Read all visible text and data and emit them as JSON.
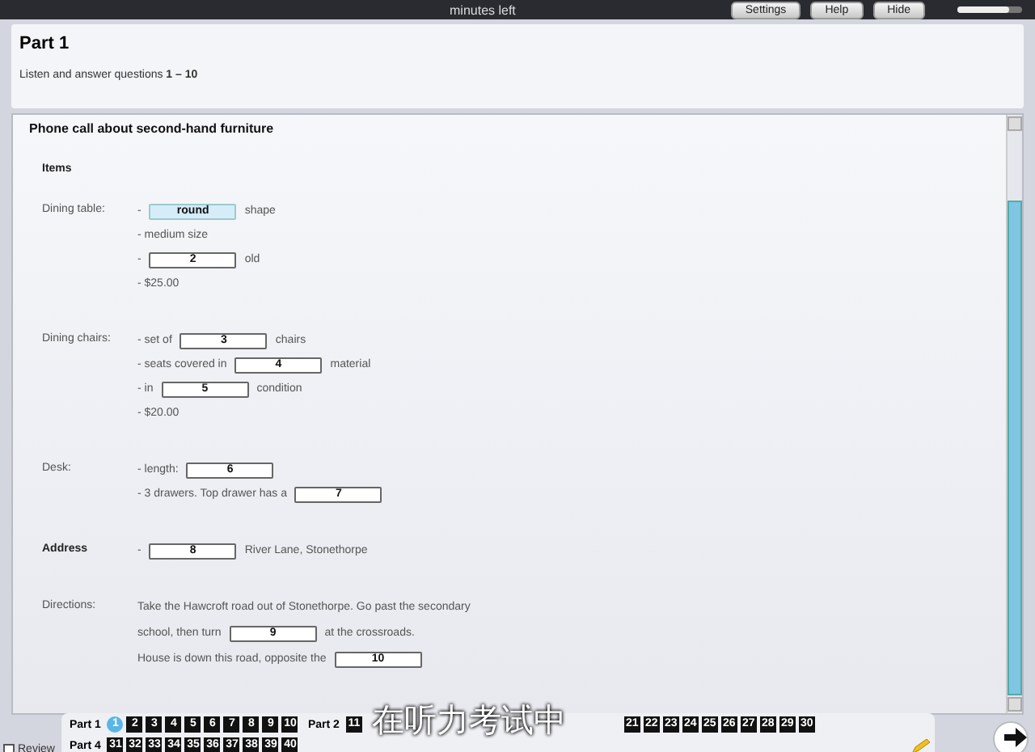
{
  "top_bar": {
    "timer": "minutes left",
    "volume": {
      "level": 0.8
    },
    "buttons": [
      {
        "label": "Settings"
      },
      {
        "label": "Help"
      },
      {
        "label": "Hide"
      }
    ]
  },
  "header": {
    "title": "Part 1",
    "instruction": "Listen and answer questions **1 – 10**"
  },
  "panel": {
    "title": "Phone call about second-hand furniture",
    "heading": "Items",
    "sections": [
      {
        "label": "Dining table:",
        "bold": false,
        "lines": [
          [
            {
              "kind": "text",
              "text": "-"
            },
            {
              "kind": "field",
              "value": "round",
              "focused": true
            },
            {
              "kind": "text",
              "text": "shape"
            }
          ],
          [
            {
              "kind": "text",
              "text": "- medium size"
            }
          ],
          [
            {
              "kind": "text",
              "text": "-"
            },
            {
              "kind": "field",
              "value": "2",
              "focused": false
            },
            {
              "kind": "text",
              "text": "old"
            }
          ],
          [
            {
              "kind": "text",
              "text": "- $25.00"
            }
          ]
        ]
      },
      {
        "label": "Dining chairs:",
        "bold": false,
        "lines": [
          [
            {
              "kind": "text",
              "text": "- set of"
            },
            {
              "kind": "field",
              "value": "3",
              "focused": false
            },
            {
              "kind": "text",
              "text": "chairs"
            }
          ],
          [
            {
              "kind": "text",
              "text": "- seats covered in"
            },
            {
              "kind": "field",
              "value": "4",
              "focused": false
            },
            {
              "kind": "text",
              "text": "material"
            }
          ],
          [
            {
              "kind": "text",
              "text": "- in"
            },
            {
              "kind": "field",
              "value": "5",
              "focused": false
            },
            {
              "kind": "text",
              "text": "condition"
            }
          ],
          [
            {
              "kind": "text",
              "text": "- $20.00"
            }
          ]
        ]
      },
      {
        "label": "Desk:",
        "bold": false,
        "lines": [
          [
            {
              "kind": "text",
              "text": "- length:"
            },
            {
              "kind": "field",
              "value": "6",
              "focused": false
            }
          ],
          [
            {
              "kind": "text",
              "text": "- 3 drawers. Top drawer has a"
            },
            {
              "kind": "field",
              "value": "7",
              "focused": false
            }
          ]
        ]
      },
      {
        "label": "Address",
        "bold": true,
        "lines": [
          [
            {
              "kind": "text",
              "text": "-"
            },
            {
              "kind": "field",
              "value": "8",
              "focused": false
            },
            {
              "kind": "text",
              "text": "River Lane, Stonethorpe"
            }
          ]
        ]
      },
      {
        "label": "Directions:",
        "bold": false,
        "lines": [
          [
            {
              "kind": "text",
              "text": "Take the Hawcroft road out of Stonethorpe. Go past the secondary"
            }
          ],
          [
            {
              "kind": "text",
              "text": "school, then turn"
            },
            {
              "kind": "field",
              "value": "9",
              "focused": false
            },
            {
              "kind": "text",
              "text": "at the crossroads."
            }
          ],
          [
            {
              "kind": "text",
              "text": "House is down this road, opposite the"
            },
            {
              "kind": "field",
              "value": "10",
              "focused": false
            }
          ]
        ]
      }
    ]
  },
  "subtitle": "在听力考试中",
  "nav": {
    "review": {
      "label": "Review",
      "checked": false
    },
    "rows": [
      [
        {
          "label": "Part 1",
          "questions": [
            {
              "n": "1",
              "selected": true
            },
            {
              "n": "2",
              "selected": false
            },
            {
              "n": "3",
              "selected": false
            },
            {
              "n": "4",
              "selected": false
            },
            {
              "n": "5",
              "selected": false
            },
            {
              "n": "6",
              "selected": false
            },
            {
              "n": "7",
              "selected": false
            },
            {
              "n": "8",
              "selected": false
            },
            {
              "n": "9",
              "selected": false
            },
            {
              "n": "10",
              "selected": false
            }
          ]
        },
        {
          "label": "Part 2",
          "questions": [
            {
              "n": "11",
              "selected": false
            }
          ]
        },
        {
          "kind": "subtitle"
        },
        {
          "questions": [
            {
              "n": "21",
              "selected": false
            },
            {
              "n": "22",
              "selected": false
            },
            {
              "n": "23",
              "selected": false
            },
            {
              "n": "24",
              "selected": false
            },
            {
              "n": "25",
              "selected": false
            },
            {
              "n": "26",
              "selected": false
            },
            {
              "n": "27",
              "selected": false
            },
            {
              "n": "28",
              "selected": false
            },
            {
              "n": "29",
              "selected": false
            },
            {
              "n": "30",
              "selected": false
            }
          ]
        }
      ],
      [
        {
          "label": "Part 4",
          "questions": [
            {
              "n": "31",
              "selected": false
            },
            {
              "n": "32",
              "selected": false
            },
            {
              "n": "33",
              "selected": false
            },
            {
              "n": "34",
              "selected": false
            },
            {
              "n": "35",
              "selected": false
            },
            {
              "n": "36",
              "selected": false
            },
            {
              "n": "37",
              "selected": false
            },
            {
              "n": "38",
              "selected": false
            },
            {
              "n": "39",
              "selected": false
            },
            {
              "n": "40",
              "selected": false
            }
          ]
        }
      ]
    ]
  }
}
